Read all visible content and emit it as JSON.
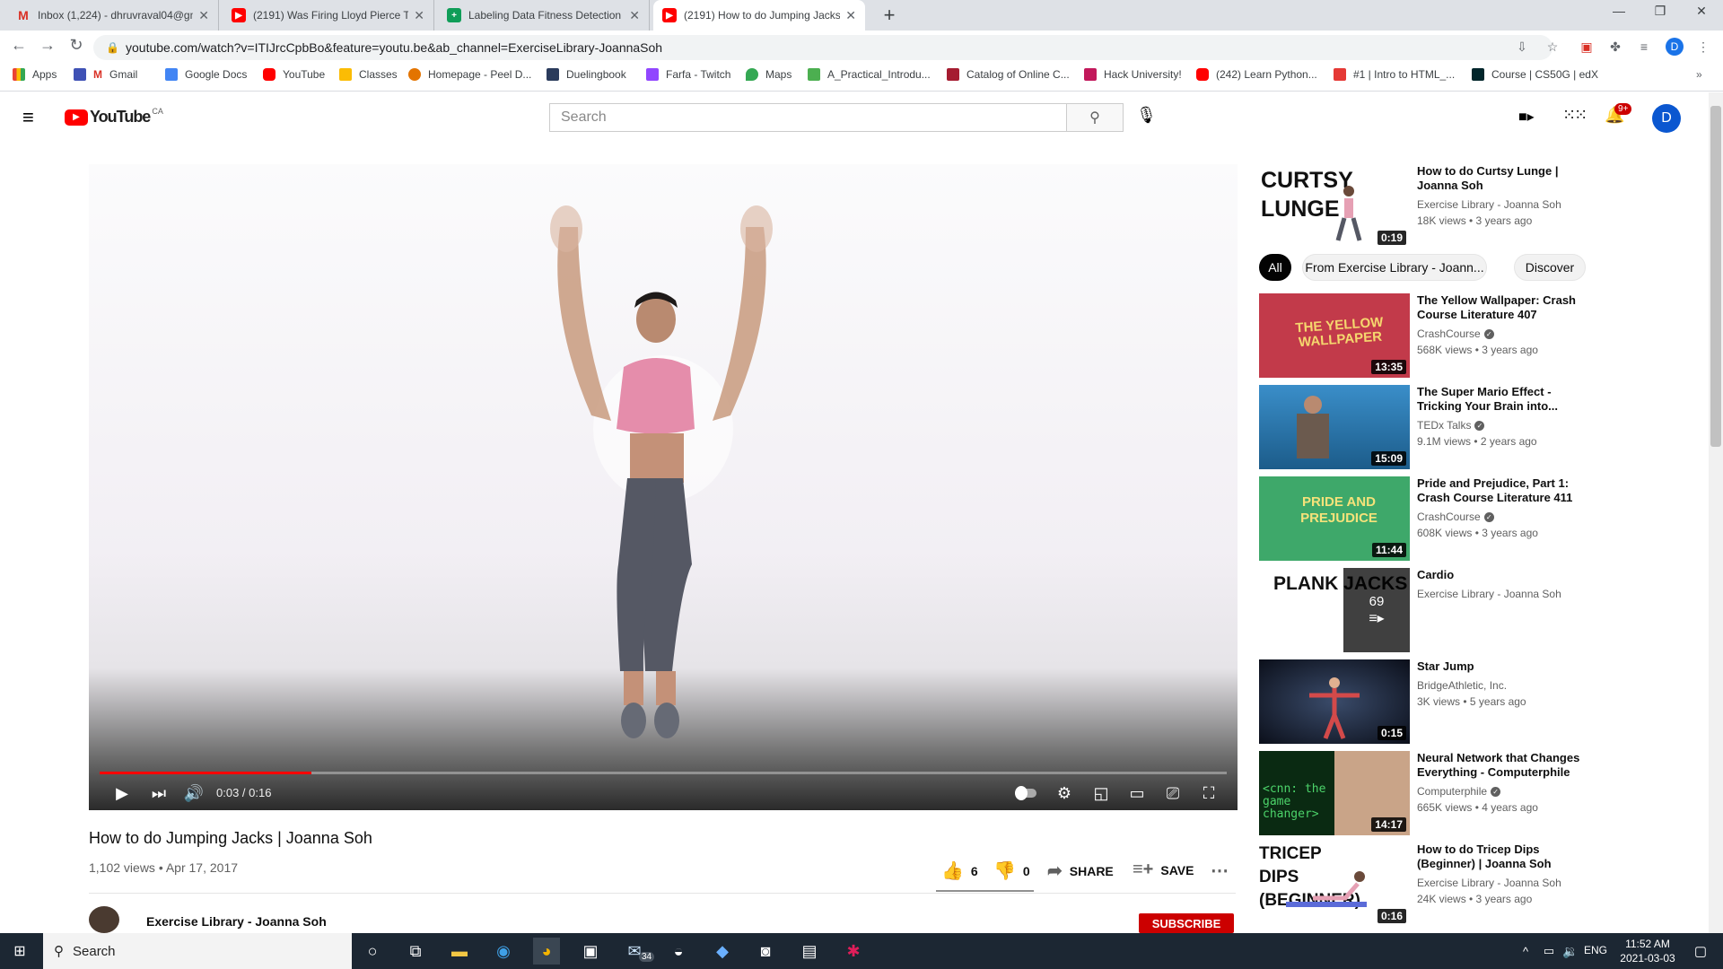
{
  "browser": {
    "tabs": [
      {
        "title": "Inbox (1,224) - dhruvraval04@gm",
        "favicon": "gmail-icon"
      },
      {
        "title": "(2191) Was Firing Lloyd Pierce Th",
        "favicon": "youtube-icon"
      },
      {
        "title": "Labeling Data Fitness Detection",
        "favicon": "sheets-icon"
      },
      {
        "title": "(2191) How to do Jumping Jacks",
        "favicon": "youtube-icon",
        "active": true
      }
    ],
    "url": "youtube.com/watch?v=ITIJrcCpbBo&feature=youtu.be&ab_channel=ExerciseLibrary-JoannaSoh",
    "profile_initial": "D",
    "bookmarks": [
      "Apps",
      "Gmail",
      "Google Docs",
      "YouTube",
      "Classes",
      "Homepage - Peel D...",
      "Duelingbook",
      "Farfa - Twitch",
      "Maps",
      "A_Practical_Introdu...",
      "Catalog of Online C...",
      "Hack University!",
      "(242) Learn Python...",
      "#1 | Intro to HTML_...",
      "Course | CS50G | edX"
    ]
  },
  "youtube": {
    "logo_text": "YouTube",
    "logo_region": "CA",
    "search_placeholder": "Search",
    "notifications_badge": "9+",
    "avatar_initial": "D",
    "player": {
      "time": "0:03 / 0:16",
      "progress": 0.1875
    },
    "video": {
      "title": "How to do Jumping Jacks | Joanna Soh",
      "meta": "1,102 views • Apr 17, 2017",
      "likes": "6",
      "dislikes": "0",
      "share_label": "SHARE",
      "save_label": "SAVE",
      "channel": "Exercise Library - Joanna Soh",
      "subscribe_label": "SUBSCRIBE"
    },
    "chips": [
      "All",
      "From Exercise Library - Joann...",
      "Discover"
    ],
    "top_card": {
      "thumb_text": [
        "CURTSY",
        "LUNGE"
      ],
      "title": "How to do Curtsy Lunge | Joanna Soh",
      "channel": "Exercise Library - Joanna Soh",
      "meta": "18K views • 3 years ago",
      "duration": "0:19"
    },
    "recommendations": [
      {
        "title": "The Yellow Wallpaper: Crash Course Literature 407",
        "channel": "CrashCourse",
        "verified": true,
        "meta": "568K views • 3 years ago",
        "duration": "13:35",
        "thumb_text": "THE YELLOW WALLPAPER"
      },
      {
        "title": "The Super Mario Effect - Tricking Your Brain into...",
        "channel": "TEDx Talks",
        "verified": true,
        "meta": "9.1M views • 2 years ago",
        "duration": "15:09",
        "thumb_text": ""
      },
      {
        "title": "Pride and Prejudice, Part 1: Crash Course Literature 411",
        "channel": "CrashCourse",
        "verified": true,
        "meta": "608K views • 3 years ago",
        "duration": "11:44",
        "thumb_text": "PRIDE AND PREJUDICE"
      },
      {
        "title": "Cardio",
        "channel": "Exercise Library - Joanna Soh",
        "verified": false,
        "meta": "",
        "duration": "69",
        "thumb_text": "PLANK JACKS"
      },
      {
        "title": "Star Jump",
        "channel": "BridgeAthletic, Inc.",
        "verified": false,
        "meta": "3K views • 5 years ago",
        "duration": "0:15",
        "thumb_text": ""
      },
      {
        "title": "Neural Network that Changes Everything - Computerphile",
        "channel": "Computerphile",
        "verified": true,
        "meta": "665K views • 4 years ago",
        "duration": "14:17",
        "thumb_text": "<cnn: the game changer>"
      },
      {
        "title": "How to do Tricep Dips (Beginner) | Joanna Soh",
        "channel": "Exercise Library - Joanna Soh",
        "verified": false,
        "meta": "24K views • 3 years ago",
        "duration": "0:16",
        "thumb_text": "TRICEP DIPS (BEGINNER)"
      }
    ]
  },
  "taskbar": {
    "search_label": "Search",
    "mail_badge": "34",
    "language": "ENG",
    "time": "11:52 AM",
    "date": "2021-03-03"
  }
}
